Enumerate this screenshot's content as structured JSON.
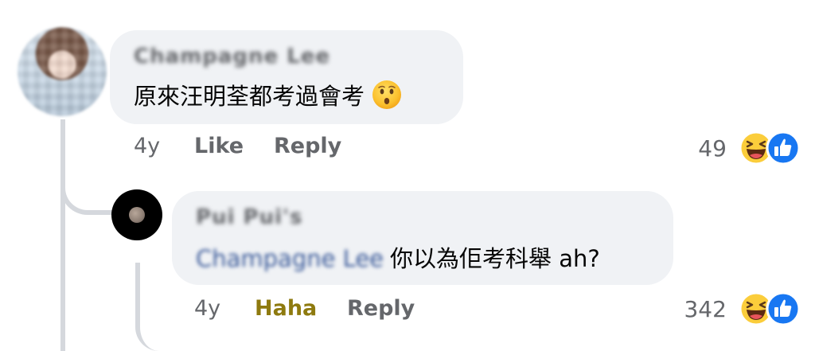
{
  "comments": [
    {
      "author": "Champagne Lee",
      "text": "原來汪明荃都考過會考",
      "emoji_icon": "hushed-face-emoji",
      "time": "4y",
      "actions": [
        "Like",
        "Reply"
      ],
      "reaction_count": "49",
      "reaction_icons": [
        "haha-reaction-icon",
        "like-reaction-icon"
      ]
    },
    {
      "author": "Pui Pui's",
      "mention": "Champagne Lee",
      "text": "你以為佢考科舉 ah?",
      "time": "4y",
      "actions": [
        "Haha",
        "Reply"
      ],
      "reaction_count": "342",
      "reaction_icons": [
        "haha-reaction-icon",
        "like-reaction-icon"
      ]
    }
  ],
  "colors": {
    "bubble_bg": "#f0f2f5",
    "meta_text": "#65676b",
    "haha_active": "#8e7a0f",
    "like_blue": "#1877f2",
    "mention_blue": "#385898"
  }
}
